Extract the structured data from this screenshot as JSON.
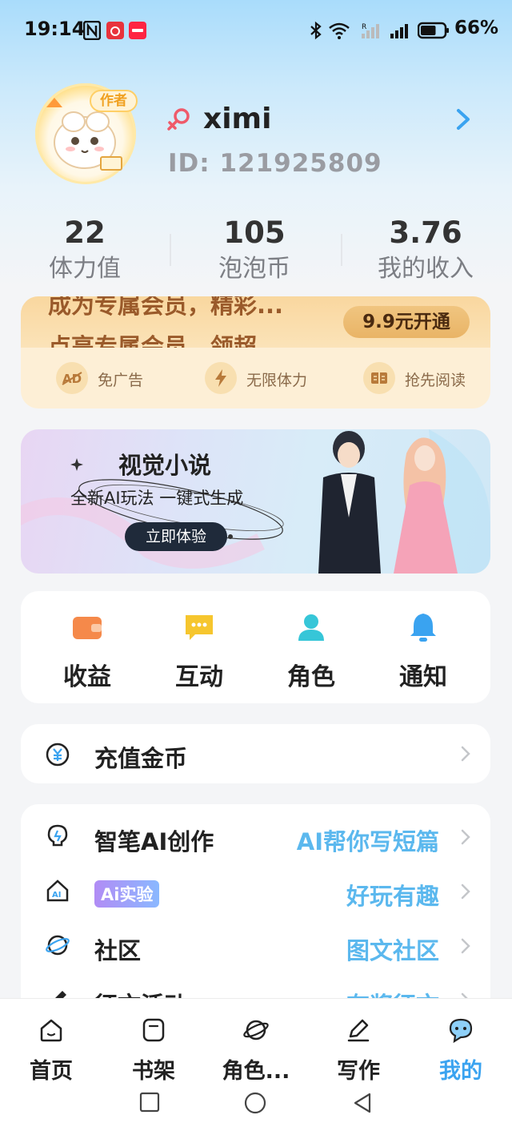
{
  "status_bar": {
    "time": "19:14",
    "battery_pct": "66%",
    "battery_level": 0.66
  },
  "profile": {
    "avatar_tag": "作者",
    "username": "ximi",
    "user_id": "ID:  121925809"
  },
  "stats": [
    {
      "value": "22",
      "label": "体力值"
    },
    {
      "value": "105",
      "label": "泡泡币"
    },
    {
      "value": "3.76",
      "label": "我的收入"
    }
  ],
  "vip": {
    "marquee_line1": "成为专属会员，精彩...",
    "marquee_line2": "点亮专属会员，领超",
    "button": "9.9元开通",
    "features": [
      {
        "icon": "ad-icon",
        "label": "免广告"
      },
      {
        "icon": "lightning-icon",
        "label": "无限体力"
      },
      {
        "icon": "book-icon",
        "label": "抢先阅读"
      }
    ]
  },
  "banner": {
    "title": "视觉小说",
    "subtitle": "全新AI玩法 一键式生成",
    "button": "立即体验"
  },
  "quick_actions": [
    {
      "icon": "wallet-icon",
      "label": "收益",
      "color": "#f5894a"
    },
    {
      "icon": "chat-icon",
      "label": "互动",
      "color": "#f6c62e"
    },
    {
      "icon": "person-icon",
      "label": "角色",
      "color": "#36c6d8"
    },
    {
      "icon": "bell-icon",
      "label": "通知",
      "color": "#3aa3f0"
    }
  ],
  "recharge": {
    "label": "充值金币"
  },
  "list": [
    {
      "icon": "lightbulb-icon",
      "title": "智笔AI创作",
      "right": "AI帮你写短篇"
    },
    {
      "icon": "ai-home-icon",
      "title": "Ai实验",
      "right": "好玩有趣"
    },
    {
      "icon": "planet-icon",
      "title": "社区",
      "right": "图文社区"
    },
    {
      "icon": "pen-icon",
      "title": "征文活动",
      "right": "有奖征文"
    }
  ],
  "bottom_nav": [
    {
      "icon": "home-icon",
      "label": "首页",
      "active": false
    },
    {
      "icon": "bookshelf-icon",
      "label": "书架",
      "active": false
    },
    {
      "icon": "planet-icon",
      "label": "角色...",
      "active": false
    },
    {
      "icon": "write-icon",
      "label": "写作",
      "active": false
    },
    {
      "icon": "profile-icon",
      "label": "我的",
      "active": true
    }
  ],
  "colors": {
    "accent": "#3aa3f0",
    "link": "#5bb8ee",
    "vip_bg": "#fdefd6",
    "vip_text": "#9a5a2a"
  }
}
